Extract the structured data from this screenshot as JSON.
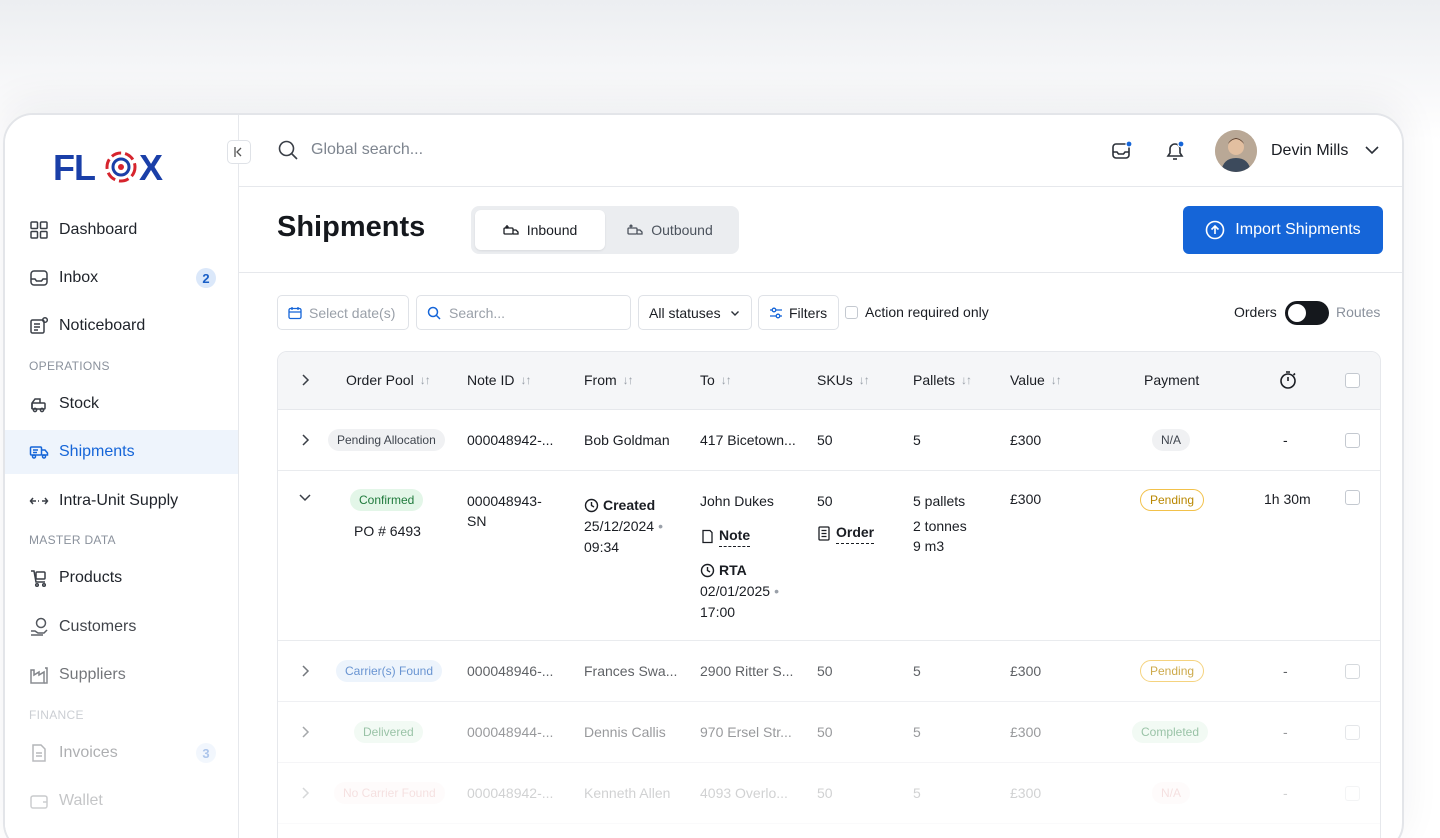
{
  "brand": {
    "logo_text": "FLOX"
  },
  "sidebar": {
    "items": [
      {
        "label": "Dashboard"
      },
      {
        "label": "Inbox",
        "badge": "2"
      },
      {
        "label": "Noticeboard"
      },
      {
        "label": "Stock"
      },
      {
        "label": "Shipments"
      },
      {
        "label": "Intra-Unit Supply"
      },
      {
        "label": "Products"
      },
      {
        "label": "Customers"
      },
      {
        "label": "Suppliers"
      },
      {
        "label": "Invoices",
        "badge": "3"
      },
      {
        "label": "Wallet"
      }
    ],
    "sections": [
      "OPERATIONS",
      "MASTER DATA",
      "FINANCE"
    ]
  },
  "topbar": {
    "search_placeholder": "Global search...",
    "user_name": "Devin Mills"
  },
  "header": {
    "title": "Shipments",
    "tabs": [
      {
        "label": "Inbound"
      },
      {
        "label": "Outbound"
      }
    ],
    "import_label": "Import Shipments"
  },
  "filters": {
    "date_placeholder": "Select date(s)",
    "search_placeholder": "Search...",
    "status_value": "All statuses",
    "filters_label": "Filters",
    "action_required_label": "Action required only",
    "toggle_left": "Orders",
    "toggle_right": "Routes"
  },
  "table": {
    "columns": [
      "Order Pool",
      "Note ID",
      "From",
      "To",
      "SKUs",
      "Pallets",
      "Value",
      "Payment"
    ],
    "rows": [
      {
        "pool": "Pending Allocation",
        "note_id": "000048942-...",
        "from": "Bob Goldman",
        "to": "417 Bicetown...",
        "skus": "50",
        "pallets": "5",
        "value": "£300",
        "payment": "N/A",
        "timer": "-"
      },
      {
        "pool": "Confirmed",
        "po": "PO # 6493",
        "note_id_line1": "000048943-",
        "note_id_line2": "SN",
        "from_label": "Created",
        "from_date": "25/12/2024",
        "from_time": "09:34",
        "to_name": "John Dukes",
        "to_note": "Note",
        "to_rta_label": "RTA",
        "to_rta_date": "02/01/2025",
        "to_rta_time": "17:00",
        "skus": "50",
        "skus_order": "Order",
        "pallets": "5 pallets",
        "tonnes": "2 tonnes",
        "volume": "9 m3",
        "value": "£300",
        "payment": "Pending",
        "timer": "1h 30m"
      },
      {
        "pool": "Carrier(s) Found",
        "note_id": "000048946-...",
        "from": "Frances Swa...",
        "to": "2900 Ritter S...",
        "skus": "50",
        "pallets": "5",
        "value": "£300",
        "payment": "Pending",
        "timer": "-"
      },
      {
        "pool": "Delivered",
        "note_id": "000048944-...",
        "from": "Dennis Callis",
        "to": "970 Ersel Str...",
        "skus": "50",
        "pallets": "5",
        "value": "£300",
        "payment": "Completed",
        "timer": "-"
      },
      {
        "pool": "No Carrier Found",
        "note_id": "000048942-...",
        "from": "Kenneth Allen",
        "to": "4093 Overlo...",
        "skus": "50",
        "pallets": "5",
        "value": "£300",
        "payment": "N/A",
        "timer": "-"
      }
    ]
  },
  "colors": {
    "primary": "#1565d8",
    "logo_blue": "#1a3fa8",
    "logo_red": "#d6242d"
  }
}
